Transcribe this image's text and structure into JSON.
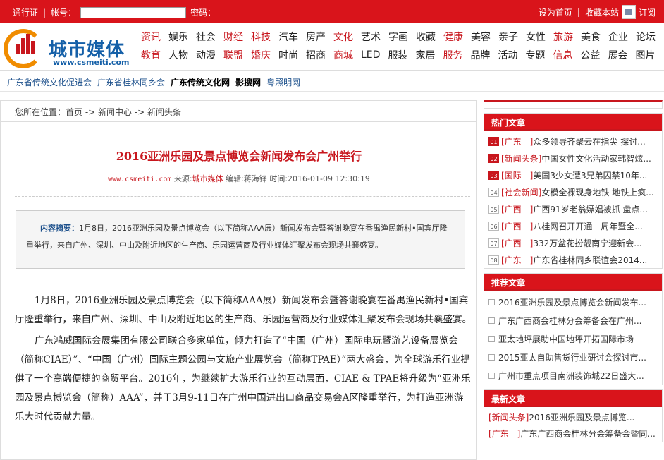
{
  "topbar": {
    "pass_label": "通行证",
    "account_label": "帐号：",
    "account_value": "",
    "password_label": "密码：",
    "set_home": "设为首页",
    "bookmark": "收藏本站",
    "subscribe": "订阅"
  },
  "logo": {
    "name": "城市媒体",
    "url": "www.csmeiti.com"
  },
  "nav": {
    "row1": [
      {
        "label": "资讯",
        "red": true
      },
      {
        "label": "娱乐",
        "red": false
      },
      {
        "label": "社会",
        "red": false
      },
      {
        "label": "财经",
        "red": true
      },
      {
        "label": "科技",
        "red": true
      },
      {
        "label": "汽车",
        "red": false
      },
      {
        "label": "房产",
        "red": false
      },
      {
        "label": "文化",
        "red": true
      },
      {
        "label": "艺术",
        "red": false
      },
      {
        "label": "字画",
        "red": false
      },
      {
        "label": "收藏",
        "red": false
      },
      {
        "label": "健康",
        "red": true
      },
      {
        "label": "美容",
        "red": false
      },
      {
        "label": "亲子",
        "red": false
      },
      {
        "label": "女性",
        "red": false
      },
      {
        "label": "旅游",
        "red": true
      },
      {
        "label": "美食",
        "red": false
      },
      {
        "label": "企业",
        "red": false
      },
      {
        "label": "论坛",
        "red": false
      }
    ],
    "row2": [
      {
        "label": "教育",
        "red": true
      },
      {
        "label": "人物",
        "red": false
      },
      {
        "label": "动漫",
        "red": false
      },
      {
        "label": "联盟",
        "red": true
      },
      {
        "label": "婚庆",
        "red": true
      },
      {
        "label": "时尚",
        "red": false
      },
      {
        "label": "招商",
        "red": false
      },
      {
        "label": "商城",
        "red": true
      },
      {
        "label": "LED",
        "red": false
      },
      {
        "label": "服装",
        "red": false
      },
      {
        "label": "家居",
        "red": false
      },
      {
        "label": "服务",
        "red": true
      },
      {
        "label": "品牌",
        "red": false
      },
      {
        "label": "活动",
        "red": false
      },
      {
        "label": "专题",
        "red": false
      },
      {
        "label": "信息",
        "red": true
      },
      {
        "label": "公益",
        "red": false
      },
      {
        "label": "展会",
        "red": false
      },
      {
        "label": "图片",
        "red": false
      }
    ]
  },
  "links": [
    {
      "label": "广东省传统文化促进会",
      "bold": false
    },
    {
      "label": "广东省桂林同乡会",
      "bold": false
    },
    {
      "label": "广东传统文化网",
      "bold": true
    },
    {
      "label": "影搜网",
      "bold": true
    },
    {
      "label": "粤照明网",
      "bold": false
    }
  ],
  "breadcrumb": "您所在位置：首页 -> 新闻中心 -> 新闻头条",
  "article": {
    "title": "2016亚洲乐园及景点博览会新闻发布会广州举行",
    "site": "www.csmeiti.com",
    "source_label": "来源:",
    "source": "城市媒体",
    "editor": "编辑:蒋海锋",
    "time": "时间:2016-01-09 12:30:19",
    "summary_label": "内容摘要：",
    "summary": "1月8日，2016亚洲乐园及景点博览会（以下简称AAA展）新闻发布会暨答谢晚宴在番禺渔民新村•国宾厅隆重举行，来自广州、深圳、中山及附近地区的生产商、乐园运营商及行业媒体汇聚发布会现场共襄盛宴。",
    "paragraphs": [
      "1月8日，2016亚洲乐园及景点博览会（以下简称AAA展）新闻发布会暨答谢晚宴在番禺渔民新村•国宾厅隆重举行，来自广州、深圳、中山及附近地区的生产商、乐园运营商及行业媒体汇聚发布会现场共襄盛宴。",
      "广东鸿威国际会展集团有限公司联合多家单位，倾力打造了“中国（广州）国际电玩暨游艺设备展览会（简称CIAE）”、“中国（广州）国际主题公园与文旅产业展览会（简称TPAE）”两大盛会，为全球游乐行业提供了一个高端便捷的商贸平台。2016年，为继续扩大游乐行业的互动层面，CIAE & TPAE将升级为“亚洲乐园及景点博览会（简称）AAA”，并于3月9-11日在广州中国进出口商品交易会A区隆重举行，为打造亚洲游乐大时代贡献力量。"
    ]
  },
  "sidebar": {
    "hot_title": "热门文章",
    "hot": [
      {
        "num": "01",
        "tag": "[广东　]",
        "text": "众多领导齐聚云在指尖  探讨..."
      },
      {
        "num": "02",
        "tag": "[新闻头条]",
        "text": "中国女性文化活动家韩智炫..."
      },
      {
        "num": "03",
        "tag": "[国际　]",
        "text": "美国3少女遭3兄弟囚禁10年..."
      },
      {
        "num": "04",
        "tag": "[社会新闻]",
        "text": "女模全裸现身地铁 地铁上疯..."
      },
      {
        "num": "05",
        "tag": "[广西　]",
        "text": "广西91岁老翁嫖娼被抓 盘点..."
      },
      {
        "num": "06",
        "tag": "[广西　]",
        "text": "八桂网召开开通一周年暨全..."
      },
      {
        "num": "07",
        "tag": "[广西　]",
        "text": "332万盆花扮靓南宁迎新会..."
      },
      {
        "num": "08",
        "tag": "[广东　]",
        "text": "广东省桂林同乡联谊会2014..."
      }
    ],
    "rec_title": "推荐文章",
    "rec": [
      "2016亚洲乐园及景点博览会新闻发布...",
      "广东广西商会桂林分会筹备会在广州...",
      "亚太地坪展助中国地坪开拓国际市场",
      "2015亚太自助售货行业研讨会探讨市...",
      "广州市重点项目南洲装饰城22日盛大..."
    ],
    "new_title": "最新文章",
    "new": [
      {
        "tag": "[新闻头条]",
        "text": "2016亚洲乐园及景点博览..."
      },
      {
        "tag": "[广东　]",
        "text": "广东广西商会桂林分会筹备会暨同..."
      }
    ]
  }
}
